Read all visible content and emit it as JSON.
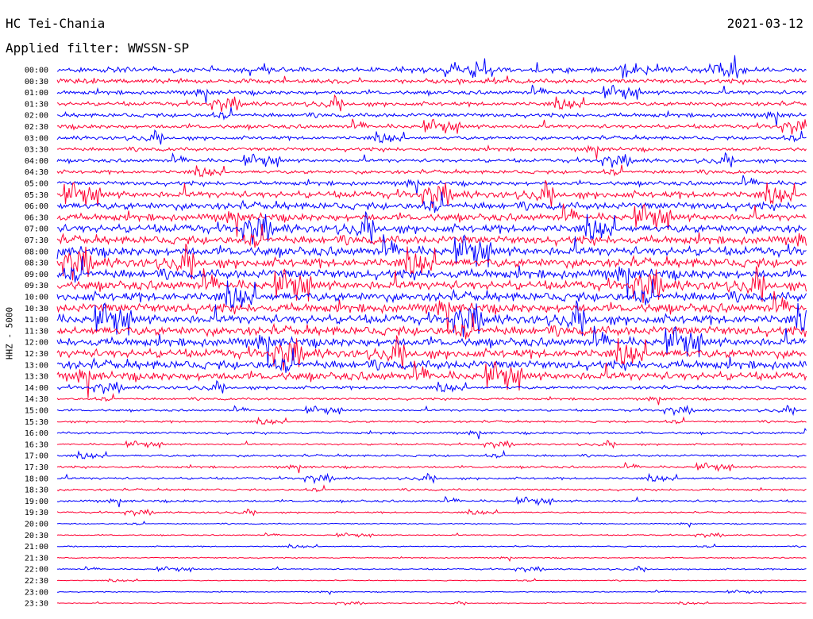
{
  "header": {
    "station": "HC Tei-Chania",
    "date": "2021-03-12",
    "filter": "Applied filter: WWSSN-SP"
  },
  "colors": {
    "trace_a": "#0000ff",
    "trace_b": "#ff0033",
    "background": "#ffffff",
    "text": "#000000"
  },
  "chart_data": {
    "type": "line",
    "title": "HC Tei-Chania",
    "subtitle": "Applied filter: WWSSN-SP",
    "ylabel": "HHZ - 5000",
    "xlabel": "",
    "grid": false,
    "row_interval_minutes": 30,
    "rows": [
      "00:00",
      "00:30",
      "01:00",
      "01:30",
      "02:00",
      "02:30",
      "03:00",
      "03:30",
      "04:00",
      "04:30",
      "05:00",
      "05:30",
      "06:00",
      "06:30",
      "07:00",
      "07:30",
      "08:00",
      "08:30",
      "09:00",
      "09:30",
      "10:00",
      "10:30",
      "11:00",
      "11:30",
      "12:00",
      "12:30",
      "13:00",
      "13:30",
      "14:00",
      "14:30",
      "15:00",
      "15:30",
      "16:00",
      "16:30",
      "17:00",
      "17:30",
      "18:00",
      "18:30",
      "19:00",
      "19:30",
      "20:00",
      "20:30",
      "21:00",
      "21:30",
      "22:00",
      "22:30",
      "23:00",
      "23:30"
    ],
    "row_colors": [
      "blue",
      "red"
    ],
    "relative_amplitude": [
      2.2,
      2.0,
      1.8,
      1.8,
      1.8,
      1.8,
      1.6,
      1.6,
      1.6,
      1.6,
      1.9,
      3.0,
      3.2,
      3.2,
      3.6,
      3.6,
      4.0,
      4.0,
      4.0,
      4.0,
      4.0,
      4.0,
      4.0,
      4.0,
      3.8,
      3.8,
      3.8,
      3.6,
      1.4,
      1.0,
      1.0,
      0.9,
      1.0,
      0.8,
      1.0,
      1.0,
      1.0,
      0.9,
      1.0,
      0.7,
      0.5,
      0.5,
      0.5,
      0.5,
      0.6,
      0.4,
      0.4,
      0.4
    ]
  }
}
